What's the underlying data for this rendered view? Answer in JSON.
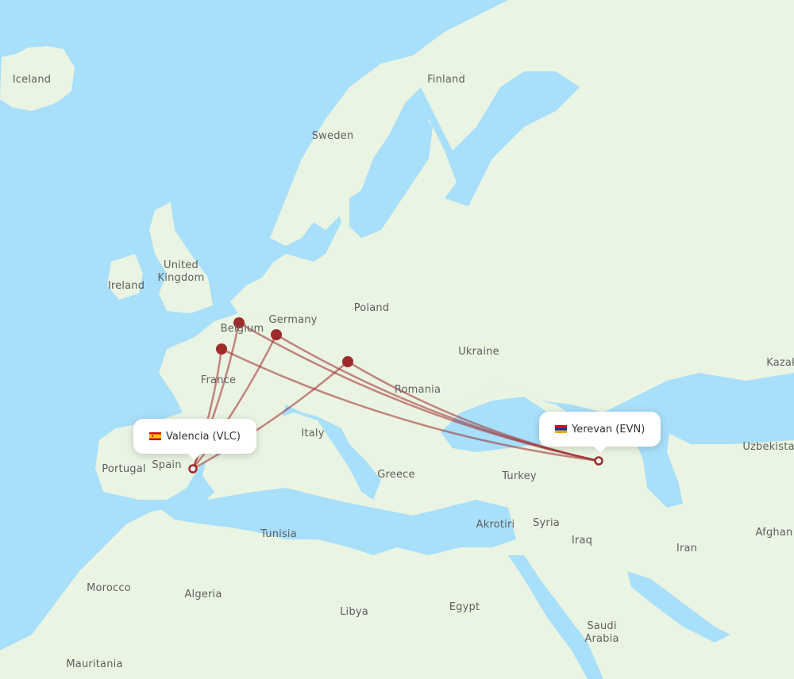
{
  "map": {
    "colors": {
      "sea": "#a8dffa",
      "land": "#eaf4e2",
      "border": "#9ccf8e",
      "route": "#9e2a2b",
      "hub": "#9e2a2b",
      "label": "#5f6060"
    },
    "origin": {
      "city": "Valencia",
      "code": "VLC",
      "label": "Valencia (VLC)",
      "country": "Spain",
      "flag": "spain-flag"
    },
    "destination": {
      "city": "Yerevan",
      "code": "EVN",
      "label": "Yerevan (EVN)",
      "country": "Armenia",
      "flag": "armenia-flag"
    },
    "hubs": [
      {
        "name": "brussels-hub"
      },
      {
        "name": "frankfurt-hub"
      },
      {
        "name": "paris-hub"
      },
      {
        "name": "vienna-hub"
      }
    ],
    "country_labels": [
      {
        "text": "Iceland"
      },
      {
        "text": "Finland"
      },
      {
        "text": "Sweden"
      },
      {
        "text": "United Kingdom"
      },
      {
        "text": "Ireland"
      },
      {
        "text": "Poland"
      },
      {
        "text": "Germany"
      },
      {
        "text": "Belgium"
      },
      {
        "text": "Ukraine"
      },
      {
        "text": "France"
      },
      {
        "text": "Romania"
      },
      {
        "text": "Kazak"
      },
      {
        "text": "Italy"
      },
      {
        "text": "Portugal"
      },
      {
        "text": "Spain"
      },
      {
        "text": "Greece"
      },
      {
        "text": "Turkey"
      },
      {
        "text": "Uzbekista"
      },
      {
        "text": "Akrotiri"
      },
      {
        "text": "Syria"
      },
      {
        "text": "Tunisia"
      },
      {
        "text": "Iraq"
      },
      {
        "text": "Iran"
      },
      {
        "text": "Afghan"
      },
      {
        "text": "Morocco"
      },
      {
        "text": "Algeria"
      },
      {
        "text": "Libya"
      },
      {
        "text": "Egypt"
      },
      {
        "text": "Saudi Arabia"
      },
      {
        "text": "Mauritania"
      }
    ]
  }
}
